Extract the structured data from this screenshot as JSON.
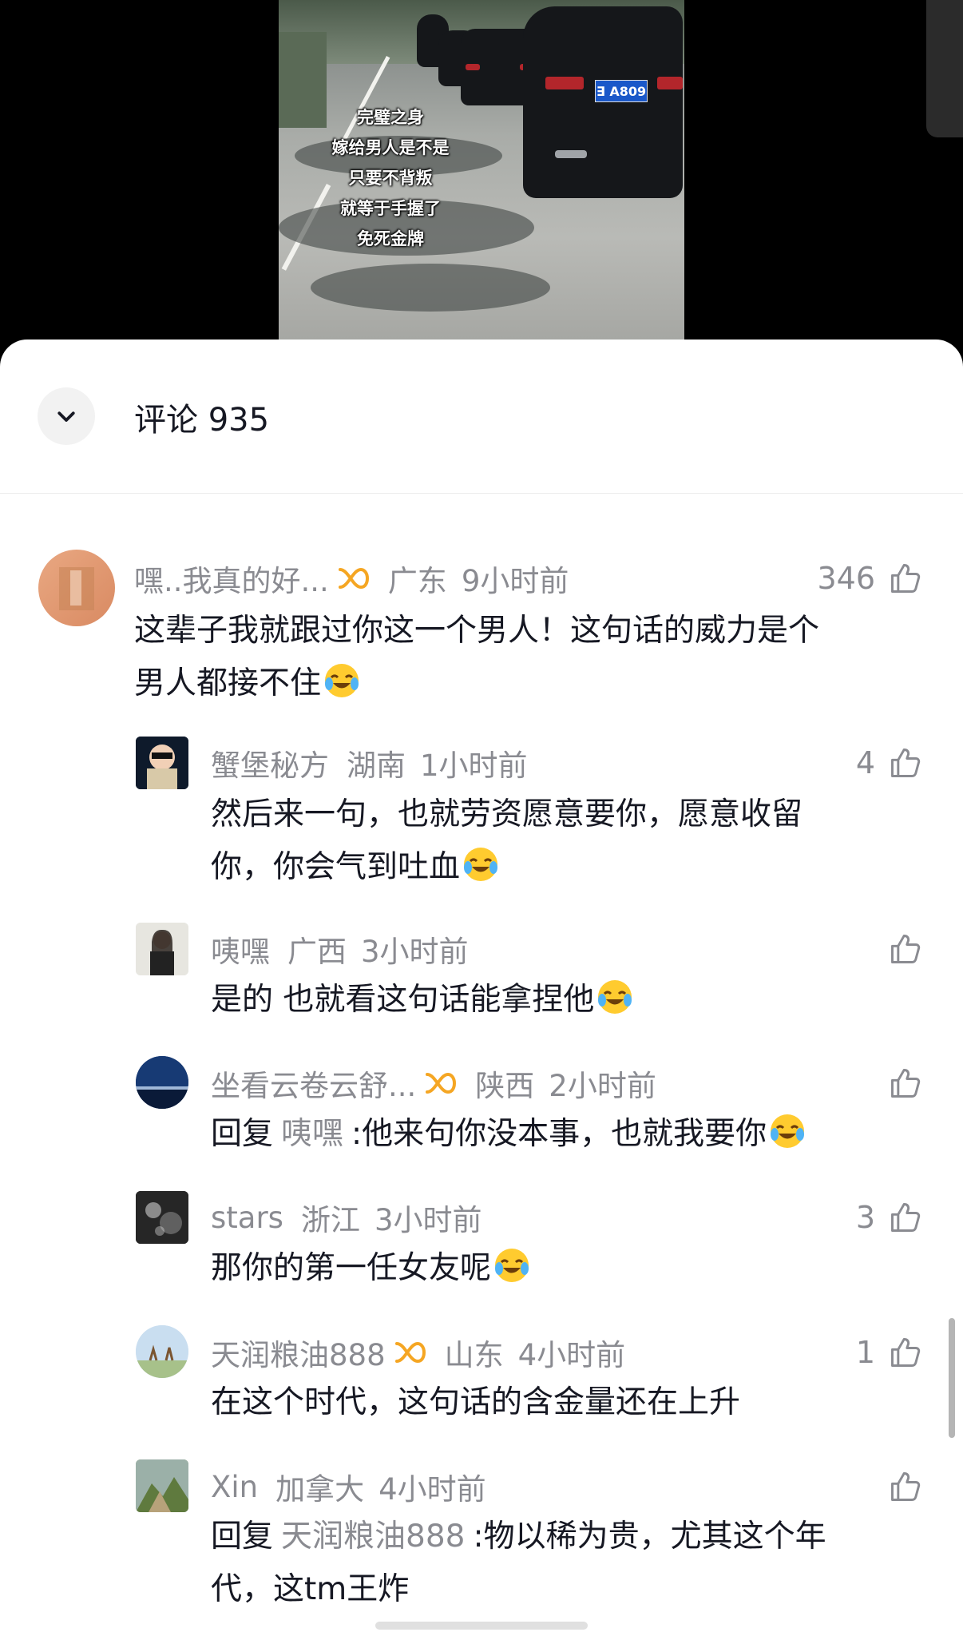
{
  "video": {
    "caption_lines": [
      "完璧之身",
      "嫁给男人是不是",
      "只要不背叛",
      "就等于手握了",
      "免死金牌"
    ],
    "plate_text": "∃ A809"
  },
  "header": {
    "title": "评论 935",
    "collapse_icon": "chevron-down-icon"
  },
  "comments": [
    {
      "name": "嘿..我真的好...",
      "has_badge": true,
      "region": "广东",
      "time": "9小时前",
      "likes": "346",
      "text": "这辈子我就跟过你这一个男人！这句话的威力是个",
      "text2": "男人都接不住",
      "emoji": "laugh-cry-emoji"
    },
    {
      "name": "蟹堡秘方",
      "region": "湖南",
      "time": "1小时前",
      "likes": "4",
      "text": "然后来一句，也就劳资愿意要你，愿意收留",
      "text2": "你，你会气到吐血",
      "emoji": "laugh-cry-emoji"
    },
    {
      "name": "咦嘿",
      "region": "广西",
      "time": "3小时前",
      "likes": "",
      "text": "是的 也就看这句话能拿捏他",
      "emoji": "laugh-cry-emoji"
    },
    {
      "name": "坐看云卷云舒...",
      "has_badge": true,
      "region": "陕西",
      "time": "2小时前",
      "likes": "",
      "reply_prefix": "回复",
      "reply_to": "咦嘿",
      "text": ":他来句你没本事，也就我要你",
      "emoji": "laugh-cry-emoji"
    },
    {
      "name": "stars",
      "region": "浙江",
      "time": "3小时前",
      "likes": "3",
      "text": "那你的第一任女友呢",
      "emoji": "laugh-cry-emoji"
    },
    {
      "name": "天润粮油888",
      "has_badge": true,
      "region": "山东",
      "time": "4小时前",
      "likes": "1",
      "text": "在这个时代，这句话的含金量还在上升"
    },
    {
      "name": "Xin",
      "region": "加拿大",
      "time": "4小时前",
      "likes": "",
      "reply_prefix": "回复",
      "reply_to": "天润粮油888",
      "text": ":物以稀为贵，尤其这个年",
      "text2": "代，这tm王炸"
    }
  ],
  "colors": {
    "badge": "#f5a623",
    "secondary_text": "#8a8b91",
    "primary_text": "#161823"
  }
}
